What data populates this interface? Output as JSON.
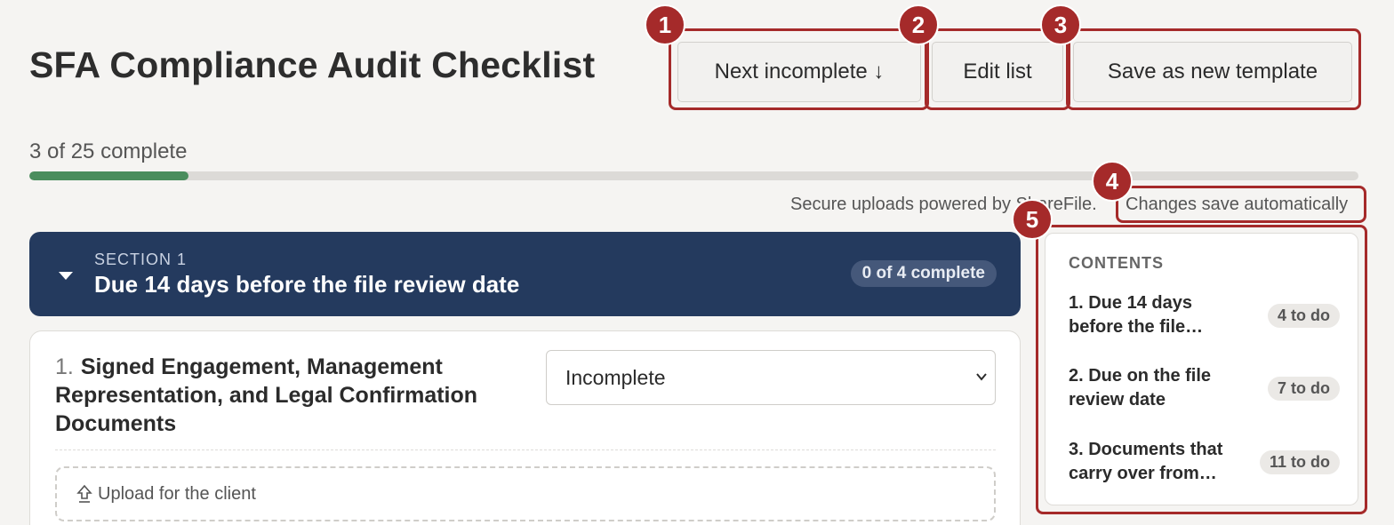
{
  "header": {
    "title": "SFA Compliance Audit Checklist",
    "next_incomplete_label": "Next incomplete ↓",
    "edit_list_label": "Edit list",
    "save_template_label": "Save as new template"
  },
  "progress": {
    "text": "3 of 25 complete",
    "completed": 3,
    "total": 25,
    "bar_color": "#4a8d5d"
  },
  "notices": {
    "secure_uploads": "Secure uploads powered by ShareFile.",
    "autosave": "Changes save automatically"
  },
  "section": {
    "kicker": "SECTION 1",
    "title": "Due 14 days before the file review date",
    "badge": "0 of 4 complete",
    "color": "#243a5e"
  },
  "item": {
    "number": "1.",
    "title": "Signed Engagement, Management Representation, and Legal Confirmation Documents",
    "status": "Incomplete",
    "upload_label": "Upload for the client"
  },
  "contents": {
    "heading": "CONTENTS",
    "items": [
      {
        "label": "1. Due 14 days before the file…",
        "badge": "4 to do"
      },
      {
        "label": "2. Due on the file review date",
        "badge": "7 to do"
      },
      {
        "label": "3. Documents that carry over from…",
        "badge": "11 to do"
      }
    ]
  },
  "annotations": {
    "color": "#a52a2a",
    "markers": [
      "1",
      "2",
      "3",
      "4",
      "5"
    ]
  }
}
